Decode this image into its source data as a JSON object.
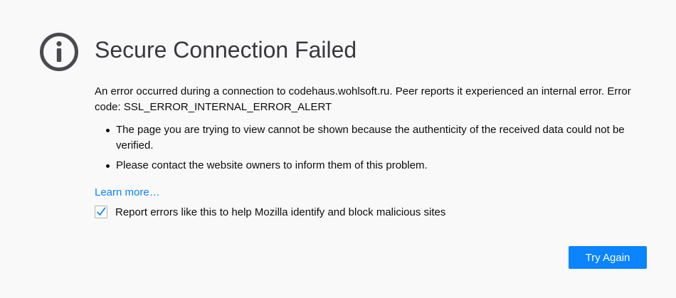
{
  "error": {
    "title": "Secure Connection Failed",
    "description": "An error occurred during a connection to codehaus.wohlsoft.ru. Peer reports it experienced an internal error. Error code: SSL_ERROR_INTERNAL_ERROR_ALERT",
    "bullets": [
      "The page you are trying to view cannot be shown because the authenticity of the received data could not be verified.",
      "Please contact the website owners to inform them of this problem."
    ],
    "learn_more": "Learn more…",
    "report_label": "Report errors like this to help Mozilla identify and block malicious sites",
    "report_checked": true,
    "try_again": "Try Again"
  },
  "icons": {
    "info": "info-icon",
    "check": "checkmark-icon"
  },
  "colors": {
    "background": "#f9f9fa",
    "accent": "#0a84ff",
    "icon": "#4a4a4f",
    "title": "#38383d"
  }
}
